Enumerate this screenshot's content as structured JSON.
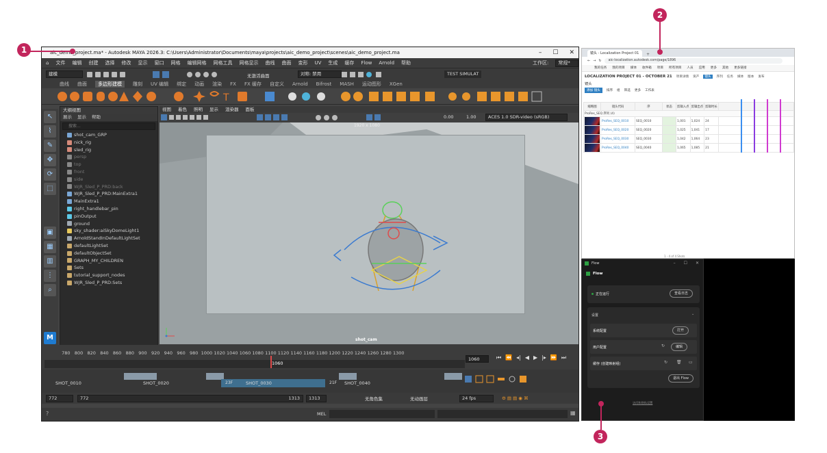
{
  "callouts": [
    "1",
    "2",
    "3"
  ],
  "maya": {
    "title": "aic_demo_project.ma* - Autodesk MAYA 2026.3: C:\\Users\\Administrator\\Documents\\maya\\projects\\aic_demo_project\\scenes\\aic_demo_project.ma",
    "menus": [
      "文件",
      "编辑",
      "创建",
      "选择",
      "修改",
      "显示",
      "窗口",
      "网格",
      "编辑网格",
      "网格工具",
      "网格显示",
      "曲线",
      "曲面",
      "变形",
      "UV",
      "生成",
      "缓存",
      "Flow",
      "Arnold",
      "帮助"
    ],
    "workspace_label": "工作区:",
    "workspace_value": "常规*",
    "mode_value": "建模",
    "no_live_surface": "无激活曲面",
    "symmetry": "对称: 禁用",
    "user": "TEST SIMULAT",
    "shelf_tabs": [
      "曲线",
      "曲面",
      "多边形建模",
      "雕刻",
      "UV 编辑",
      "绑定",
      "动画",
      "渲染",
      "FX",
      "FX 缓存",
      "自定义",
      "Arnold",
      "Bifrost",
      "MASH",
      "运动图形",
      "XGen"
    ],
    "outliner": {
      "panel_title": "大纲视图",
      "menus": [
        "展示",
        "显示",
        "帮助"
      ],
      "search_placeholder": "搜索...",
      "items": [
        {
          "label": "shot_cam_GRP",
          "dim": false,
          "color": "#7aa7d6"
        },
        {
          "label": "nick_rig",
          "dim": false,
          "color": "#d68a7a"
        },
        {
          "label": "sled_rig",
          "dim": false,
          "color": "#d68a7a"
        },
        {
          "label": "persp",
          "dim": true,
          "color": "#888888"
        },
        {
          "label": "top",
          "dim": true,
          "color": "#888888"
        },
        {
          "label": "front",
          "dim": true,
          "color": "#888888"
        },
        {
          "label": "side",
          "dim": true,
          "color": "#888888"
        },
        {
          "label": "WJR_Sled_P_PRD:back",
          "dim": true,
          "color": "#888888"
        },
        {
          "label": "WJR_Sled_P_PRD:MainExtra1",
          "dim": false,
          "color": "#7aa7d6"
        },
        {
          "label": "MainExtra1",
          "dim": false,
          "color": "#7aa7d6"
        },
        {
          "label": "right_handlebar_pin",
          "dim": false,
          "color": "#5cc8e6"
        },
        {
          "label": "pinOutput",
          "dim": false,
          "color": "#5cc8e6"
        },
        {
          "label": "ground",
          "dim": false,
          "color": "#9fa9b3"
        },
        {
          "label": "sky_shader:aiSkyDomeLight1",
          "dim": false,
          "color": "#e6c85c"
        },
        {
          "label": "ArnoldStandInDefaultLightSet",
          "dim": false,
          "color": "#9fa9b3"
        },
        {
          "label": "defaultLightSet",
          "dim": false,
          "color": "#c9a86a"
        },
        {
          "label": "defaultObjectSet",
          "dim": false,
          "color": "#c9a86a"
        },
        {
          "label": "GRAPH_MY_CHILDREN",
          "dim": false,
          "color": "#c9a86a"
        },
        {
          "label": "Sets",
          "dim": false,
          "color": "#c9a86a"
        },
        {
          "label": "tutorial_support_nodes",
          "dim": false,
          "color": "#c9a86a"
        },
        {
          "label": "WJR_Sled_P_PRD:Sets",
          "dim": false,
          "color": "#c9a86a"
        }
      ]
    },
    "viewport": {
      "menus": [
        "视图",
        "着色",
        "照明",
        "显示",
        "渲染器",
        "面板"
      ],
      "resolution": "1920 x 1080",
      "camera": "shot_cam",
      "exposure": "0.00",
      "gamma": "1.00",
      "colorspace": "ACES 1.0 SDR-video (sRGB)"
    },
    "timeline": {
      "ticks": [
        "780",
        "800",
        "820",
        "840",
        "860",
        "880",
        "900",
        "920",
        "940",
        "960",
        "980",
        "1000",
        "1020",
        "1040",
        "1060",
        "1080",
        "1100",
        "1120",
        "1140",
        "1160",
        "1180",
        "1200",
        "1220",
        "1240",
        "1260",
        "1280",
        "1300"
      ],
      "current": "1060",
      "current_field": "1060"
    },
    "shots": [
      {
        "name": "SHOT_0010"
      },
      {
        "name": "SHOT_0020"
      },
      {
        "name": "SHOT_0030"
      },
      {
        "name": "SHOT_0040"
      }
    ],
    "shot_marks": [
      "23F",
      "21F"
    ],
    "range": {
      "start": "772",
      "inner_start": "772",
      "inner_end": "1313",
      "end": "1313",
      "character_set": "无角色集",
      "anim_layer": "无动画层",
      "fps": "24 fps"
    },
    "cmd_label": "MEL"
  },
  "browser": {
    "tab_title": "镜头 - Localization Project 01",
    "url": "aic-localization.autodesk.com/page/1896",
    "nav": [
      "我的任务",
      "我的项目",
      "媒体",
      "收件箱",
      "项目",
      "所有项目",
      "人员",
      "应用",
      "更多",
      "其他",
      "更多链接"
    ],
    "project_title": "LOCALIZATION PROJECT 01 - OCTOBER 21",
    "project_tabs": [
      "项目详情",
      "资产",
      "镜头",
      "序列",
      "任务",
      "媒体",
      "版本",
      "发布"
    ],
    "section": "镜头",
    "toolbar": [
      "添加 镜头",
      "排序",
      "组",
      "筛选",
      "更多",
      "工作表"
    ],
    "columns": [
      "缩略图",
      "镜头代码",
      "序",
      "状态",
      "剪辑入点",
      "剪辑出点",
      "剪辑时长"
    ],
    "rows": [
      {
        "code": "ProRes_SEQ_0010",
        "seq": "SEQ_0010",
        "in": "1,001",
        "out": "1,024",
        "dur": "24"
      },
      {
        "code": "ProRes_SEQ_0020",
        "seq": "SEQ_0020",
        "in": "1,025",
        "out": "1,041",
        "dur": "17"
      },
      {
        "code": "ProRes_SEQ_0030",
        "seq": "SEQ_0030",
        "in": "1,042",
        "out": "1,064",
        "dur": "23"
      },
      {
        "code": "ProRes_SEQ_0040",
        "seq": "SEQ_0040",
        "in": "1,065",
        "out": "1,085",
        "dur": "21"
      }
    ],
    "group_row": "ProRes_SEQ 序列 (4)",
    "footer": "1 - 4 of 4 Shots"
  },
  "flow": {
    "window_title": "Flow",
    "app_name": "Flow",
    "running_label": "正在运行",
    "view_log": "查看日志",
    "settings": "设置",
    "system_config": "系统配置",
    "open": "打开",
    "user_config": "用户配置",
    "edit": "编辑",
    "cache": "缓存 (创建映射组)",
    "quit": "退出 Flow",
    "link": "访问和隐私设置"
  }
}
